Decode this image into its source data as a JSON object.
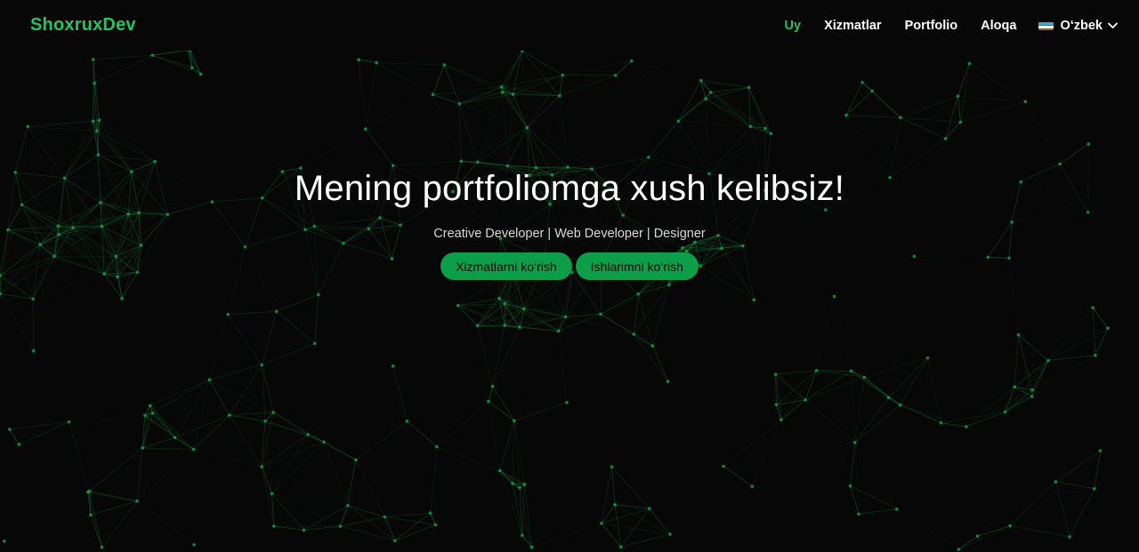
{
  "colors": {
    "accent": "#22c55e",
    "button_bg": "#0c9e49",
    "button_text": "#0a0a0a",
    "active_link": "#22c55e",
    "network": "#16a34a"
  },
  "navbar": {
    "brand": "ShoxruxDev",
    "links": [
      {
        "label": "Uy",
        "active": true
      },
      {
        "label": "Xizmatlar",
        "active": false
      },
      {
        "label": "Portfolio",
        "active": false
      },
      {
        "label": "Aloqa",
        "active": false
      }
    ],
    "language": {
      "flag_icon": "uzbekistan-flag-icon",
      "label": "O‘zbek",
      "dropdown_icon": "chevron-down-icon"
    }
  },
  "hero": {
    "title": "Mening portfoliomga xush kelibsiz!",
    "subtitle": "Creative Developer | Web Developer | Designer",
    "buttons": [
      {
        "label": "Xizmatlarni ko‘rish"
      },
      {
        "label": "Ishlarimni ko‘rish"
      }
    ]
  }
}
